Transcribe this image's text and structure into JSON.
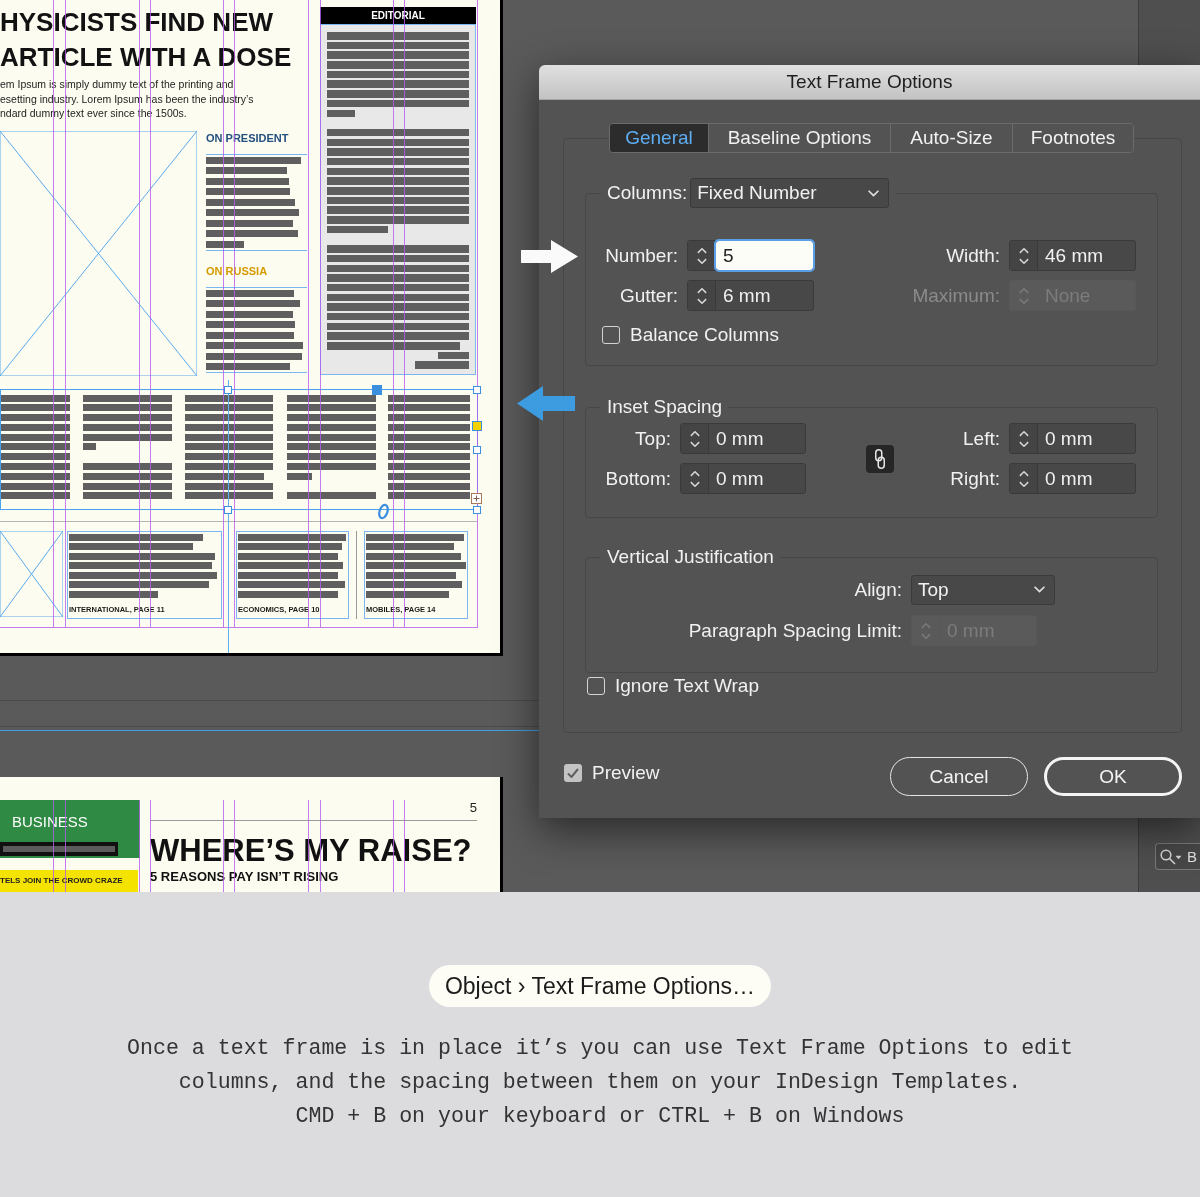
{
  "document": {
    "page_1": {
      "headline_lines": [
        "HYSICISTS FIND NEW",
        "ARTICLE WITH A DOSE"
      ],
      "intro_lines": [
        "em Ipsum is simply dummy text of the printing and",
        "esetting industry. Lorem Ipsum has been the industry’s",
        "ndard dummy text ever since the 1500s."
      ],
      "side_stories": [
        {
          "heading": "ON PRESIDENT",
          "color": "#24507f"
        },
        {
          "heading": "ON RUSSIA",
          "color": "#d49b00"
        }
      ],
      "editorial": {
        "heading": "EDITORIAL"
      },
      "teasers": [
        {
          "caption": "INTERNATIONAL, PAGE 11"
        },
        {
          "caption": "ECONOMICS, PAGE 10"
        },
        {
          "caption": "MOBILES, PAGE 14"
        }
      ]
    },
    "page_2": {
      "section": "BUSINESS",
      "strip": "TELS JOIN THE CROWD CRAZE",
      "page_number": "5",
      "headline": "WHERE’S MY RAISE?",
      "subheadline": "5 REASONS PAY ISN’T RISING"
    }
  },
  "side_panel": {
    "search": {
      "value": "B"
    }
  },
  "dialog": {
    "title": "Text Frame Options",
    "tabs": [
      {
        "label": "General",
        "selected": true
      },
      {
        "label": "Baseline Options",
        "selected": false
      },
      {
        "label": "Auto-Size",
        "selected": false
      },
      {
        "label": "Footnotes",
        "selected": false
      }
    ],
    "columns": {
      "label": "Columns:",
      "mode": "Fixed Number",
      "fields": [
        {
          "label": "Number:",
          "value": "5",
          "focused": true,
          "disabled": false,
          "label_disabled": false
        },
        {
          "label": "Width:",
          "value": "46 mm",
          "focused": false,
          "disabled": false,
          "label_disabled": false
        },
        {
          "label": "Gutter:",
          "value": "6 mm",
          "focused": false,
          "disabled": false,
          "label_disabled": false
        },
        {
          "label": "Maximum:",
          "value": "None",
          "focused": false,
          "disabled": true,
          "label_disabled": true
        }
      ],
      "balance": {
        "label": "Balance Columns",
        "checked": false
      }
    },
    "inset": {
      "title": "Inset Spacing",
      "fields": [
        {
          "label": "Top:",
          "value": "0 mm"
        },
        {
          "label": "Left:",
          "value": "0 mm"
        },
        {
          "label": "Bottom:",
          "value": "0 mm"
        },
        {
          "label": "Right:",
          "value": "0 mm"
        }
      ],
      "link": {
        "on": true
      }
    },
    "vertical_justification": {
      "title": "Vertical Justification",
      "fields": [
        {
          "kind": "dropdown",
          "label": "Align:",
          "value": "Top",
          "disabled": false
        },
        {
          "kind": "stepper",
          "label": "Paragraph Spacing Limit:",
          "value": "0 mm",
          "disabled": true
        }
      ]
    },
    "ignore_text_wrap": {
      "label": "Ignore Text Wrap",
      "checked": false
    },
    "preview": {
      "label": "Preview",
      "checked": true
    },
    "buttons": [
      {
        "label": "Cancel",
        "default": false
      },
      {
        "label": "OK",
        "default": true
      }
    ]
  },
  "caption": {
    "menu_path": "Object › Text Frame Options…",
    "description": "Once a text frame is in place it’s you can use Text Frame Options to edit columns, and the spacing between them on your InDesign Templates.",
    "shortcut": "CMD + B on your keyboard or CTRL + B on Windows"
  }
}
